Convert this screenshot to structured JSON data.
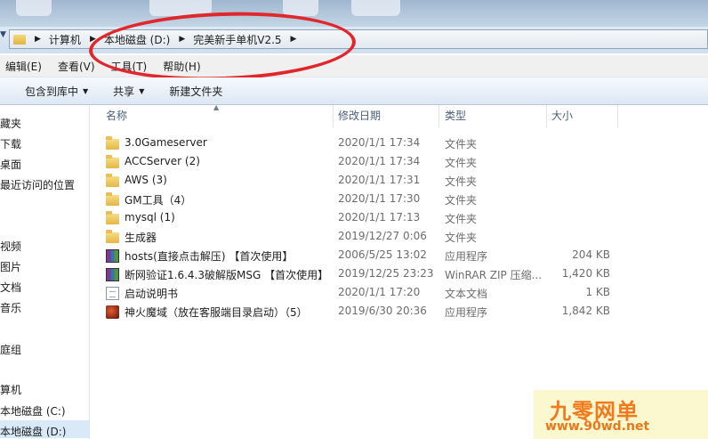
{
  "address_bar": {
    "crumbs": [
      "计算机",
      "本地磁盘 (D:)",
      "完美新手单机V2.5"
    ]
  },
  "menu": {
    "items": [
      "编辑(E)",
      "查看(V)",
      "工具(T)",
      "帮助(H)"
    ]
  },
  "toolbar": {
    "include_label": "包含到库中",
    "share_label": "共享",
    "new_folder_label": "新建文件夹"
  },
  "nav": {
    "items": [
      "藏夹",
      "下载",
      "桌面",
      "最近访问的位置",
      "视频",
      "图片",
      "文档",
      "音乐",
      "庭组",
      "算机",
      "本地磁盘 (C:)",
      "本地磁盘 (D:)"
    ]
  },
  "columns": {
    "name": "名称",
    "modified": "修改日期",
    "type": "类型",
    "size": "大小"
  },
  "files": [
    {
      "icon": "folder-icon",
      "name": "3.0Gameserver",
      "date": "2020/1/1 17:34",
      "type": "文件夹",
      "size": ""
    },
    {
      "icon": "folder-icon",
      "name": "ACCServer (2)",
      "date": "2020/1/1 17:34",
      "type": "文件夹",
      "size": ""
    },
    {
      "icon": "folder-icon",
      "name": "AWS (3)",
      "date": "2020/1/1 17:31",
      "type": "文件夹",
      "size": ""
    },
    {
      "icon": "folder-icon",
      "name": "GM工具（4）",
      "date": "2020/1/1 17:30",
      "type": "文件夹",
      "size": ""
    },
    {
      "icon": "folder-icon",
      "name": "mysql (1)",
      "date": "2020/1/1 17:13",
      "type": "文件夹",
      "size": ""
    },
    {
      "icon": "folder-icon",
      "name": "生成器",
      "date": "2019/12/27 0:06",
      "type": "文件夹",
      "size": ""
    },
    {
      "icon": "rar-archive-icon",
      "name": "hosts(直接点击解压) 【首次使用】",
      "date": "2006/5/25 13:02",
      "type": "应用程序",
      "size": "204 KB"
    },
    {
      "icon": "rar-archive-icon",
      "name": "断网验证1.6.4.3破解版MSG 【首次使用】",
      "date": "2019/12/25 23:23",
      "type": "WinRAR ZIP 压缩...",
      "size": "1,420 KB"
    },
    {
      "icon": "text-document-icon",
      "name": "启动说明书",
      "date": "2020/1/1 17:20",
      "type": "文本文档",
      "size": "1 KB"
    },
    {
      "icon": "game-app-icon",
      "name": "神火魔域（放在客服端目录启动）（5）",
      "date": "2019/6/30 20:36",
      "type": "应用程序",
      "size": "1,842 KB"
    }
  ],
  "watermark": {
    "title": "九零网单",
    "url": "www.90wd.net"
  },
  "colors": {
    "annotation_oval": "#e0272b",
    "watermark_text": "#f07a1c",
    "selection": "#d9e9f8"
  }
}
